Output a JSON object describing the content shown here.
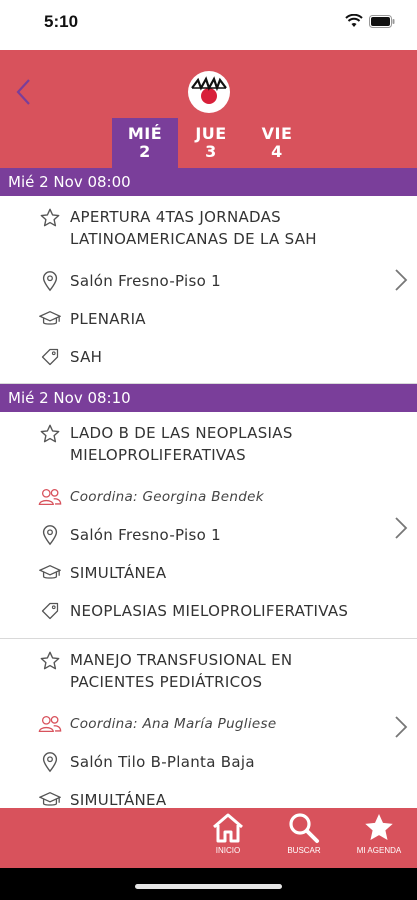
{
  "status_bar": {
    "time": "5:10"
  },
  "header": {
    "back_icon": "chevron-left-icon",
    "logo_icon": "sah-logo-icon",
    "day_tabs": [
      {
        "day": "MIÉ",
        "num": "2",
        "active": true
      },
      {
        "day": "JUE",
        "num": "3",
        "active": false
      },
      {
        "day": "VIE",
        "num": "4",
        "active": false
      }
    ]
  },
  "sections": [
    {
      "header": "Mié 2 Nov 08:00",
      "sessions": [
        {
          "title_line1": "APERTURA 4TAS JORNADAS",
          "title_line2": "LATINOAMERICANAS DE LA SAH",
          "location": "Salón Fresno-Piso 1",
          "type": "PLENARIA",
          "tag": "SAH"
        }
      ]
    },
    {
      "header": "Mié 2 Nov 08:10",
      "sessions": [
        {
          "title_line1": "LADO B DE LAS NEOPLASIAS",
          "title_line2": "MIELOPROLIFERATIVAS",
          "coordinator": "Coordina: Georgina Bendek",
          "location": "Salón Fresno-Piso 1",
          "type": "SIMULTÁNEA",
          "tag": "NEOPLASIAS MIELOPROLIFERATIVAS"
        },
        {
          "title_line1": "MANEJO TRANSFUSIONAL EN",
          "title_line2": "PACIENTES PEDIÁTRICOS",
          "coordinator": "Coordina: Ana María Pugliese",
          "location": "Salón Tilo B-Planta Baja",
          "type": "SIMULTÁNEA"
        }
      ]
    }
  ],
  "tabbar": {
    "home_label": "INICIO",
    "search_label": "BUSCAR",
    "agenda_label": "MI AGENDA"
  },
  "colors": {
    "header_red": "#d8525c",
    "accent_purple": "#7a3e9a",
    "coord_icon_red": "#d8525c"
  }
}
